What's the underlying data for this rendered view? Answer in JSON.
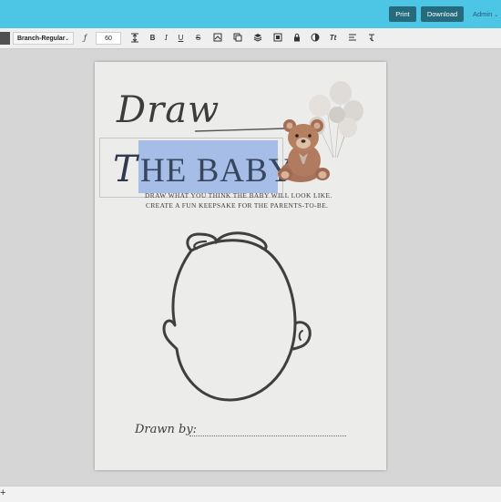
{
  "header": {
    "print_label": "Print",
    "download_label": "Download",
    "admin_label": "Admin"
  },
  "toolbar": {
    "font_name": "Branch-Regular",
    "font_size": "60",
    "swatch_color": "#505050",
    "bold_label": "B",
    "italic_label": "I",
    "underline_label": "U",
    "strike_label": "S",
    "tt_label": "Tt"
  },
  "card": {
    "draw_script": "Draw",
    "title_rest": "HE BABY",
    "subtitle_line1": "DRAW WHAT YOU THINK THE BABY WILL LOOK LIKE.",
    "subtitle_line2": "CREATE A FUN KEEPSAKE FOR THE PARENTS-TO-BE.",
    "drawn_by": "Drawn by:"
  },
  "bottom": {
    "plus_label": "+"
  },
  "colors": {
    "topbar": "#4cc6e4",
    "button": "#256a7d",
    "title_text": "#36465e",
    "selection": "#5a8ce1"
  }
}
